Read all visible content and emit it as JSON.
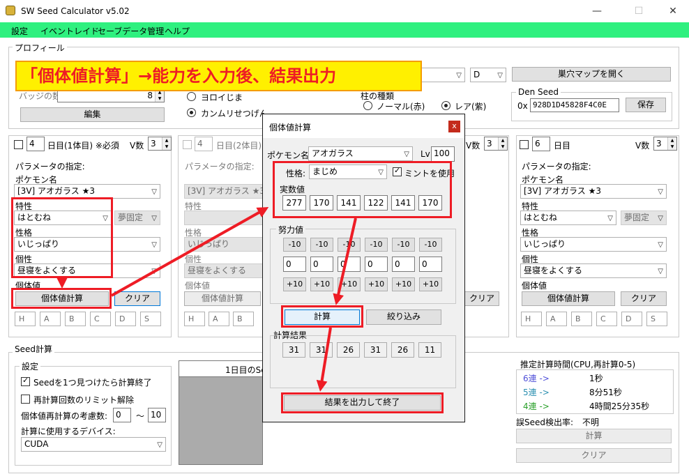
{
  "window": {
    "title": "SW Seed Calculator v5.02",
    "minimize": "—",
    "maximize": "☐",
    "close": "✕"
  },
  "menu": [
    "設定",
    "イベントレイド",
    "セーブデータ管理",
    "ヘルプ"
  ],
  "banner": "「個体値計算」→能力を入力後、結果出力",
  "profile": {
    "label": "プロフィール",
    "badge_label": "バッジの数",
    "badge_value": "8",
    "edit": "編集",
    "story": "ヨロイじま",
    "story2": "カンムリせつげん",
    "den_value": "D",
    "open_map": "巣穴マップを開く",
    "rarity_label": "柱の種類",
    "normal": "ノーマル(赤)",
    "rare": "レア(紫)",
    "den_seed_label": "Den Seed",
    "hex_prefix": "0x",
    "den_seed": "928D1D45828F4C0E",
    "save": "保存"
  },
  "panel1": {
    "number": "4",
    "day": "日目(1体目) ※必須",
    "vlabel": "V数",
    "v": "3",
    "param": "パラメータの指定:",
    "poke_label": "ポケモン名",
    "poke": "[3V] アオガラス ★3",
    "ability_label": "特性",
    "ability": "はとむね",
    "ability2": "夢固定",
    "nature_label": "性格",
    "nature": "いじっぱり",
    "char_label": "個性",
    "char": "昼寝をよくする",
    "iv_label": "個体値",
    "calc": "個体値計算",
    "clear": "クリア",
    "stats": [
      "H",
      "A",
      "B",
      "C",
      "D",
      "S"
    ]
  },
  "panel2": {
    "number": "4",
    "day": "日目(2体目)",
    "param": "パラメータの指定:",
    "poke": "[3V] アオガラス ★3",
    "ability_label": "特性",
    "nature_label": "性格",
    "nature": "いじっぱり",
    "char_label": "個性",
    "char": "昼寝をよくする",
    "iv_label": "個体値",
    "calc": "個体値計算",
    "stats": [
      "H",
      "A",
      "B"
    ]
  },
  "panel3": {
    "vlabel": "V数",
    "v": "3",
    "clear": "クリア"
  },
  "panel4": {
    "number": "6",
    "day": "日目",
    "vlabel": "V数",
    "v": "3",
    "param": "パラメータの指定:",
    "poke_label": "ポケモン名",
    "poke": "[3V] アオガラス ★3",
    "ability_label": "特性",
    "ability": "はとむね",
    "ability2": "夢固定",
    "nature_label": "性格",
    "nature": "いじっぱり",
    "char_label": "個性",
    "char": "昼寝をよくする",
    "iv_label": "個体値",
    "calc": "個体値計算",
    "clear": "クリア",
    "stats": [
      "H",
      "A",
      "B",
      "C",
      "D",
      "S"
    ]
  },
  "seed": {
    "label": "Seed計算",
    "settings": "設定",
    "stop": "Seedを1つ見つけたら計算終了",
    "unlimit": "再計算回数のリミット解除",
    "iv_recalc": "個体値再計算の考慮数:",
    "from": "0",
    "tilde": "～",
    "to": "10",
    "device_label": "計算に使用するデバイス:",
    "device": "CUDA",
    "col": "1日目のSe"
  },
  "estimate": {
    "title": "推定計算時間(CPU,再計算0-5)",
    "rows": [
      {
        "k": "6連 ->",
        "v": "1秒",
        "c": "#4f4fd8"
      },
      {
        "k": "5連 ->",
        "v": "8分51秒",
        "c": "#2a8fb0"
      },
      {
        "k": "4連 ->",
        "v": "4時間25分35秒",
        "c": "#2aa02a"
      }
    ],
    "err_label": "誤Seed検出率:",
    "err": "不明",
    "calc": "計算",
    "clear": "クリア"
  },
  "dialog": {
    "title": "個体値計算",
    "close": "x",
    "poke_label": "ポケモン名:",
    "poke": "アオガラス",
    "lv_label": "Lv",
    "lv": "100",
    "nature_label": "性格:",
    "nature": "まじめ",
    "mint": "ミントを使用",
    "stat_label": "実数値",
    "stats": [
      "277",
      "170",
      "141",
      "122",
      "141",
      "170"
    ],
    "ev_label": "努力値",
    "minus": "-10",
    "plus": "+10",
    "evs": [
      "0",
      "0",
      "0",
      "0",
      "0",
      "0"
    ],
    "calc": "計算",
    "narrow": "絞り込み",
    "result_label": "計算結果",
    "results": [
      "31",
      "31",
      "26",
      "31",
      "26",
      "11"
    ],
    "output": "結果を出力して終了"
  }
}
